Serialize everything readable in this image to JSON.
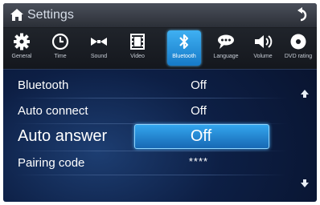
{
  "header": {
    "title": "Settings",
    "icons": {
      "home": "home-icon",
      "back": "back-arrow-icon"
    }
  },
  "tabs": [
    {
      "label": "General",
      "icon": "gear-icon",
      "active": false
    },
    {
      "label": "Time",
      "icon": "clock-icon",
      "active": false
    },
    {
      "label": "Sound",
      "icon": "sound-icon",
      "active": false
    },
    {
      "label": "Video",
      "icon": "film-icon",
      "active": false
    },
    {
      "label": "Bluetooth",
      "icon": "bluetooth-icon",
      "active": true
    },
    {
      "label": "Language",
      "icon": "speech-bubble-icon",
      "active": false
    },
    {
      "label": "Volume",
      "icon": "speaker-icon",
      "active": false
    },
    {
      "label": "DVD rating",
      "icon": "disc-icon",
      "active": false
    }
  ],
  "rows": [
    {
      "label": "Bluetooth",
      "value": "Off",
      "selected": false
    },
    {
      "label": "Auto connect",
      "value": "Off",
      "selected": false
    },
    {
      "label": "Auto answer",
      "value": "Off",
      "selected": true
    },
    {
      "label": "Pairing code",
      "value": "****",
      "selected": false
    }
  ],
  "scroll": {
    "up_icon": "arrow-up-icon",
    "down_icon": "arrow-down-icon"
  },
  "colors": {
    "accent": "#2a8fdc",
    "background": "#0d1f45",
    "text": "#ffffff"
  }
}
